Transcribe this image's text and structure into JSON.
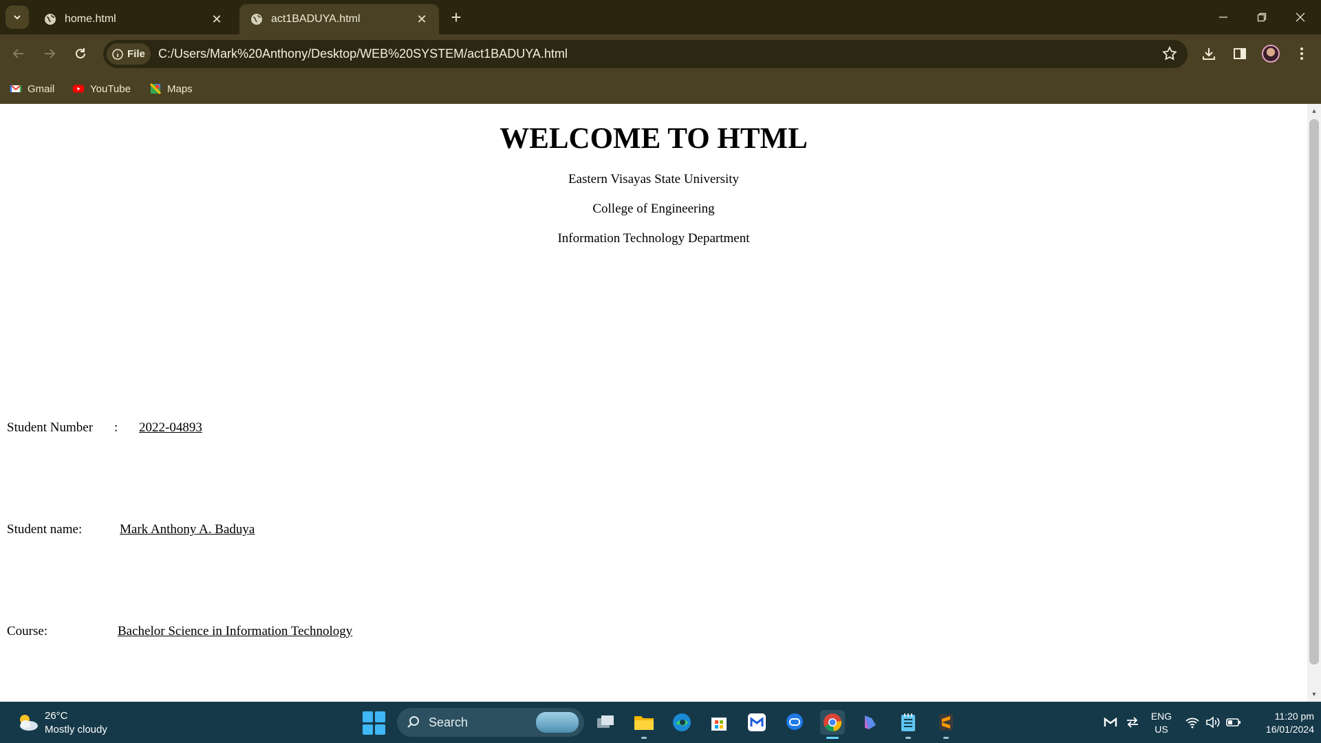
{
  "browser": {
    "tabs": [
      {
        "label": "home.html",
        "active": false
      },
      {
        "label": "act1BADUYA.html",
        "active": true
      }
    ],
    "address": {
      "chip_label": "File",
      "url": "C:/Users/Mark%20Anthony/Desktop/WEB%20SYSTEM/act1BADUYA.html"
    },
    "bookmarks": [
      {
        "label": "Gmail",
        "icon": "gmail-icon"
      },
      {
        "label": "YouTube",
        "icon": "youtube-icon"
      },
      {
        "label": "Maps",
        "icon": "maps-icon"
      }
    ],
    "colors": {
      "frame": "#2b2510",
      "toolbar": "#4a4124"
    }
  },
  "page": {
    "title": "WELCOME TO HTML",
    "lines": [
      "Eastern Visayas State University",
      "College of Engineering",
      "Information Technology Department"
    ],
    "fields": [
      {
        "label": "Student Number",
        "separator": ":",
        "value": "2022-04893"
      },
      {
        "label": "Student name:",
        "value": "Mark Anthony A. Baduya"
      },
      {
        "label": "Course:",
        "value": "Bachelor Science in Information Technology"
      }
    ]
  },
  "taskbar": {
    "weather": {
      "temp": "26°C",
      "condition": "Mostly cloudy"
    },
    "search_placeholder": "Search",
    "apps": [
      "task-view",
      "file-explorer",
      "edge",
      "microsoft-store",
      "gmail-pwa",
      "messenger",
      "chrome",
      "copilot",
      "notepad",
      "sublime-text"
    ],
    "active_app": "chrome",
    "language": {
      "line1": "ENG",
      "line2": "US"
    },
    "time": "11:20 pm",
    "date": "16/01/2024"
  }
}
